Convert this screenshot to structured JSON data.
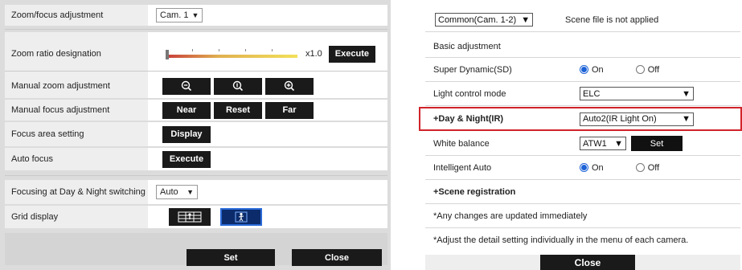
{
  "left": {
    "zoom_focus": {
      "label": "Zoom/focus adjustment",
      "camera_value": "Cam. 1"
    },
    "zoom_ratio": {
      "label": "Zoom ratio designation",
      "value_text": "x1.0",
      "execute_label": "Execute",
      "level": 0.0
    },
    "manual_zoom": {
      "label": "Manual zoom adjustment",
      "icons": [
        "zoom-out-icon",
        "zoom-1x-icon",
        "zoom-in-icon"
      ]
    },
    "manual_focus": {
      "label": "Manual focus adjustment",
      "near": "Near",
      "reset": "Reset",
      "far": "Far"
    },
    "focus_area": {
      "label": "Focus area setting",
      "display_label": "Display"
    },
    "auto_focus": {
      "label": "Auto focus",
      "execute_label": "Execute"
    },
    "day_night_focus": {
      "label": "Focusing at Day & Night switching",
      "value": "Auto"
    },
    "grid_display": {
      "label": "Grid display",
      "options": [
        "grid-icon",
        "person-icon"
      ],
      "selected": 1
    },
    "footer": {
      "set": "Set",
      "close": "Close"
    }
  },
  "right": {
    "camera_select": "Common(Cam. 1-2)",
    "scene_status": "Scene file is not applied",
    "basic_adjustment": "Basic adjustment",
    "super_dynamic": {
      "label": "Super Dynamic(SD)",
      "on": "On",
      "off": "Off",
      "selected": "On"
    },
    "light_control": {
      "label": "Light control mode",
      "value": "ELC"
    },
    "day_night": {
      "label": "+Day & Night(IR)",
      "value": "Auto2(IR Light On)"
    },
    "white_balance": {
      "label": "White balance",
      "value": "ATW1",
      "set": "Set"
    },
    "intelligent_auto": {
      "label": "Intelligent Auto",
      "on": "On",
      "off": "Off",
      "selected": "On"
    },
    "scene_registration": "+Scene registration",
    "note1": "*Any changes are updated immediately",
    "note2": "*Adjust the detail setting individually in the menu of each camera.",
    "close": "Close",
    "highlight_color": "#d1232a",
    "radio_color": "#1c62d6"
  }
}
